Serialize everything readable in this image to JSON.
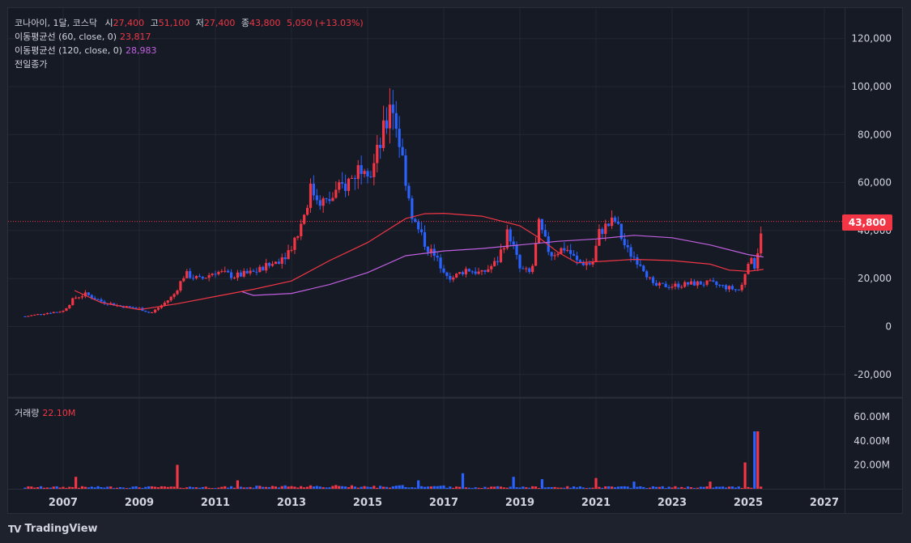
{
  "legend": {
    "title": "코나아이, 1달, 코스닥",
    "open_label": "시",
    "open": "27,400",
    "high_label": "고",
    "high": "51,100",
    "low_label": "저",
    "low": "27,400",
    "close_label": "종",
    "close": "43,800",
    "change": "5,050 (+13.03%)",
    "ma60_label": "이동평균선 (60, close, 0)",
    "ma60_value": "23,817",
    "ma120_label": "이동평균선 (120, close, 0)",
    "ma120_value": "28,983",
    "prev_close_label": "전일종가",
    "volume_label": "거래량",
    "volume_value": "22.10M"
  },
  "price_badge": "43,800",
  "brand": {
    "name": "TradingView",
    "logo": "TV"
  },
  "colors": {
    "up": "#f23645",
    "down": "#2962ff",
    "ma60": "#f23645",
    "ma120": "#c060e0",
    "prev_close_line": "#f23645",
    "background": "#161a25",
    "grid": "#232733"
  },
  "chart_data": {
    "type": "candlestick",
    "interval": "1 month",
    "x_ticks": [
      "2007",
      "2009",
      "2011",
      "2013",
      "2015",
      "2017",
      "2019",
      "2021",
      "2023",
      "2025",
      "2027"
    ],
    "y_ticks": [
      "-20,000",
      "0",
      "20,000",
      "40,000",
      "60,000",
      "80,000",
      "100,000",
      "120,000"
    ],
    "y_range": [
      -25000,
      125000
    ],
    "volume_ticks": [
      "20.00M",
      "40.00M",
      "60.00M"
    ],
    "volume_range": [
      0,
      60
    ],
    "last_close": 43800,
    "price_path": [
      [
        2006.0,
        4200
      ],
      [
        2006.5,
        5500
      ],
      [
        2007.0,
        6500
      ],
      [
        2007.3,
        12000
      ],
      [
        2007.6,
        13500
      ],
      [
        2008.0,
        10500
      ],
      [
        2008.5,
        8500
      ],
      [
        2009.0,
        7500
      ],
      [
        2009.3,
        5500
      ],
      [
        2009.6,
        9000
      ],
      [
        2009.9,
        13000
      ],
      [
        2010.2,
        22000
      ],
      [
        2010.6,
        19500
      ],
      [
        2011.0,
        23000
      ],
      [
        2011.5,
        21000
      ],
      [
        2012.0,
        22500
      ],
      [
        2012.5,
        26000
      ],
      [
        2012.9,
        31000
      ],
      [
        2013.2,
        40000
      ],
      [
        2013.5,
        57000
      ],
      [
        2013.9,
        51000
      ],
      [
        2014.2,
        56000
      ],
      [
        2014.6,
        62000
      ],
      [
        2014.9,
        70000
      ],
      [
        2015.1,
        64000
      ],
      [
        2015.5,
        85000
      ],
      [
        2015.6,
        97000
      ],
      [
        2015.8,
        80000
      ],
      [
        2016.0,
        62000
      ],
      [
        2016.2,
        44000
      ],
      [
        2016.5,
        35000
      ],
      [
        2016.8,
        28000
      ],
      [
        2017.2,
        20000
      ],
      [
        2017.6,
        24000
      ],
      [
        2018.0,
        22000
      ],
      [
        2018.4,
        27000
      ],
      [
        2018.7,
        40000
      ],
      [
        2019.0,
        24000
      ],
      [
        2019.3,
        22000
      ],
      [
        2019.5,
        42000
      ],
      [
        2019.8,
        30000
      ],
      [
        2020.2,
        33000
      ],
      [
        2020.5,
        27000
      ],
      [
        2020.9,
        26000
      ],
      [
        2021.1,
        40000
      ],
      [
        2021.5,
        44000
      ],
      [
        2021.8,
        32000
      ],
      [
        2022.2,
        26000
      ],
      [
        2022.5,
        17000
      ],
      [
        2023.0,
        17000
      ],
      [
        2023.6,
        18000
      ],
      [
        2024.0,
        18000
      ],
      [
        2024.5,
        16000
      ],
      [
        2024.8,
        15000
      ],
      [
        2025.0,
        28000
      ],
      [
        2025.2,
        25000
      ],
      [
        2025.3,
        38800
      ],
      [
        2025.4,
        43800
      ]
    ],
    "ma60_path": [
      [
        2007.3,
        15000
      ],
      [
        2008.0,
        10000
      ],
      [
        2009.0,
        7000
      ],
      [
        2010.0,
        9500
      ],
      [
        2011.0,
        12500
      ],
      [
        2012.0,
        15500
      ],
      [
        2013.0,
        19000
      ],
      [
        2014.0,
        27500
      ],
      [
        2015.0,
        35000
      ],
      [
        2015.5,
        40000
      ],
      [
        2016.0,
        45000
      ],
      [
        2016.5,
        47000
      ],
      [
        2017.0,
        47200
      ],
      [
        2018.0,
        46000
      ],
      [
        2019.0,
        42000
      ],
      [
        2019.5,
        37000
      ],
      [
        2020.0,
        31000
      ],
      [
        2020.5,
        26500
      ],
      [
        2021.0,
        27000
      ],
      [
        2022.0,
        28000
      ],
      [
        2023.0,
        27500
      ],
      [
        2024.0,
        26000
      ],
      [
        2024.5,
        23500
      ],
      [
        2025.0,
        23000
      ],
      [
        2025.4,
        23817
      ]
    ],
    "ma120_path": [
      [
        2011.7,
        14500
      ],
      [
        2012.0,
        13000
      ],
      [
        2013.0,
        13800
      ],
      [
        2014.0,
        17500
      ],
      [
        2015.0,
        22500
      ],
      [
        2016.0,
        29500
      ],
      [
        2017.0,
        31500
      ],
      [
        2018.0,
        32500
      ],
      [
        2019.0,
        34000
      ],
      [
        2020.0,
        35500
      ],
      [
        2021.0,
        36500
      ],
      [
        2022.0,
        38000
      ],
      [
        2023.0,
        37000
      ],
      [
        2024.0,
        34000
      ],
      [
        2025.0,
        30000
      ],
      [
        2025.4,
        28983
      ]
    ],
    "volume_spikes": [
      [
        2007.3,
        10
      ],
      [
        2010.0,
        20
      ],
      [
        2011.6,
        7
      ],
      [
        2016.3,
        7
      ],
      [
        2017.5,
        13
      ],
      [
        2018.8,
        10
      ],
      [
        2019.6,
        8
      ],
      [
        2021.0,
        9
      ],
      [
        2022.0,
        6
      ],
      [
        2024.0,
        6
      ],
      [
        2024.9,
        22
      ],
      [
        2025.2,
        48
      ],
      [
        2025.4,
        22.1
      ]
    ]
  }
}
